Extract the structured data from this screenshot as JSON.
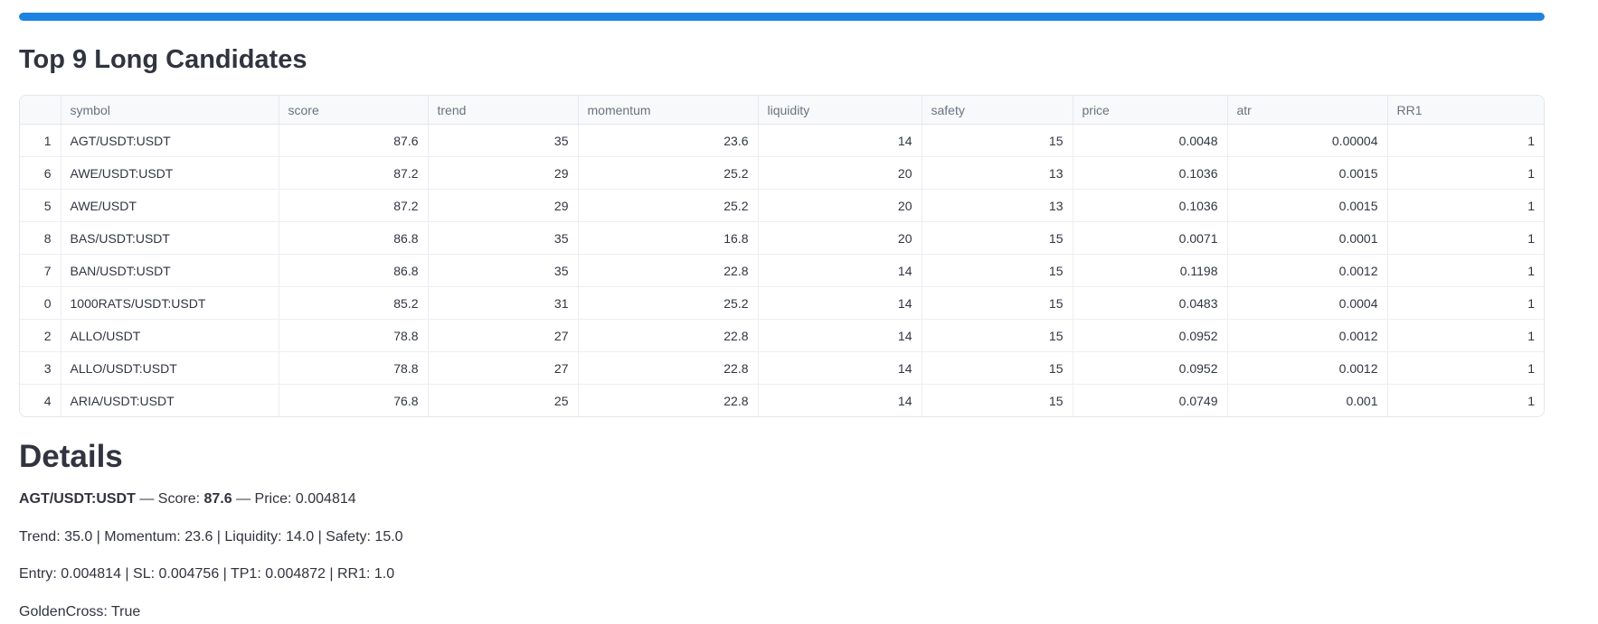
{
  "progress": {
    "value_percent": 100,
    "color": "#1c83e1"
  },
  "candidates_section": {
    "title": "Top 9 Long Candidates",
    "table": {
      "columns": [
        "",
        "symbol",
        "score",
        "trend",
        "momentum",
        "liquidity",
        "safety",
        "price",
        "atr",
        "RR1"
      ],
      "rows": [
        {
          "index": "1",
          "symbol": "AGT/USDT:USDT",
          "score": "87.6",
          "trend": "35",
          "momentum": "23.6",
          "liquidity": "14",
          "safety": "15",
          "price": "0.0048",
          "atr": "0.00004",
          "rr1": "1"
        },
        {
          "index": "6",
          "symbol": "AWE/USDT:USDT",
          "score": "87.2",
          "trend": "29",
          "momentum": "25.2",
          "liquidity": "20",
          "safety": "13",
          "price": "0.1036",
          "atr": "0.0015",
          "rr1": "1"
        },
        {
          "index": "5",
          "symbol": "AWE/USDT",
          "score": "87.2",
          "trend": "29",
          "momentum": "25.2",
          "liquidity": "20",
          "safety": "13",
          "price": "0.1036",
          "atr": "0.0015",
          "rr1": "1"
        },
        {
          "index": "8",
          "symbol": "BAS/USDT:USDT",
          "score": "86.8",
          "trend": "35",
          "momentum": "16.8",
          "liquidity": "20",
          "safety": "15",
          "price": "0.0071",
          "atr": "0.0001",
          "rr1": "1"
        },
        {
          "index": "7",
          "symbol": "BAN/USDT:USDT",
          "score": "86.8",
          "trend": "35",
          "momentum": "22.8",
          "liquidity": "14",
          "safety": "15",
          "price": "0.1198",
          "atr": "0.0012",
          "rr1": "1"
        },
        {
          "index": "0",
          "symbol": "1000RATS/USDT:USDT",
          "score": "85.2",
          "trend": "31",
          "momentum": "25.2",
          "liquidity": "14",
          "safety": "15",
          "price": "0.0483",
          "atr": "0.0004",
          "rr1": "1"
        },
        {
          "index": "2",
          "symbol": "ALLO/USDT",
          "score": "78.8",
          "trend": "27",
          "momentum": "22.8",
          "liquidity": "14",
          "safety": "15",
          "price": "0.0952",
          "atr": "0.0012",
          "rr1": "1"
        },
        {
          "index": "3",
          "symbol": "ALLO/USDT:USDT",
          "score": "78.8",
          "trend": "27",
          "momentum": "22.8",
          "liquidity": "14",
          "safety": "15",
          "price": "0.0952",
          "atr": "0.0012",
          "rr1": "1"
        },
        {
          "index": "4",
          "symbol": "ARIA/USDT:USDT",
          "score": "76.8",
          "trend": "25",
          "momentum": "22.8",
          "liquidity": "14",
          "safety": "15",
          "price": "0.0749",
          "atr": "0.001",
          "rr1": "1"
        }
      ]
    }
  },
  "details_section": {
    "heading": "Details",
    "summary": {
      "symbol": "AGT/USDT:USDT",
      "dash": "—",
      "score_label": "Score:",
      "score_value": "87.6",
      "price_label": "Price:",
      "price_value": "0.004814"
    },
    "metrics_line": "Trend: 35.0 | Momentum: 23.6 | Liquidity: 14.0 | Safety: 15.0",
    "levels_line": "Entry: 0.004814 | SL: 0.004756 | TP1: 0.004872 | RR1: 1.0",
    "signal_line": "GoldenCross: True"
  }
}
